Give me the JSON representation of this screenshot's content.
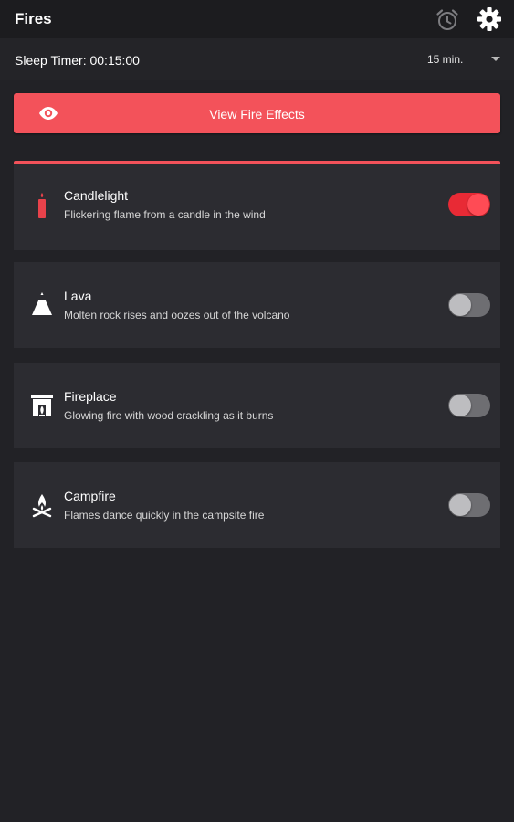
{
  "app": {
    "title": "Fires"
  },
  "toolbar": {
    "alarm_icon": "alarm-clock-icon",
    "settings_icon": "gear-icon"
  },
  "sleep_timer": {
    "label": "Sleep Timer: 00:15:00",
    "selected_option": "15 min."
  },
  "effects_button": {
    "label": "View Fire Effects",
    "icon": "eye-icon"
  },
  "colors": {
    "accent": "#f3525a",
    "background": "#222226",
    "card": "#2c2c31",
    "toggle_on": "#e82a35",
    "toggle_off": "#6e6e72"
  },
  "fires": [
    {
      "name": "Candlelight",
      "description": "Flickering flame from a candle in the wind",
      "icon": "candle-icon",
      "enabled": true
    },
    {
      "name": "Lava",
      "description": "Molten rock rises and oozes out of the volcano",
      "icon": "volcano-icon",
      "enabled": false
    },
    {
      "name": "Fireplace",
      "description": "Glowing fire with wood crackling as it burns",
      "icon": "fireplace-icon",
      "enabled": false
    },
    {
      "name": "Campfire",
      "description": "Flames dance quickly in the campsite fire",
      "icon": "campfire-icon",
      "enabled": false
    }
  ]
}
